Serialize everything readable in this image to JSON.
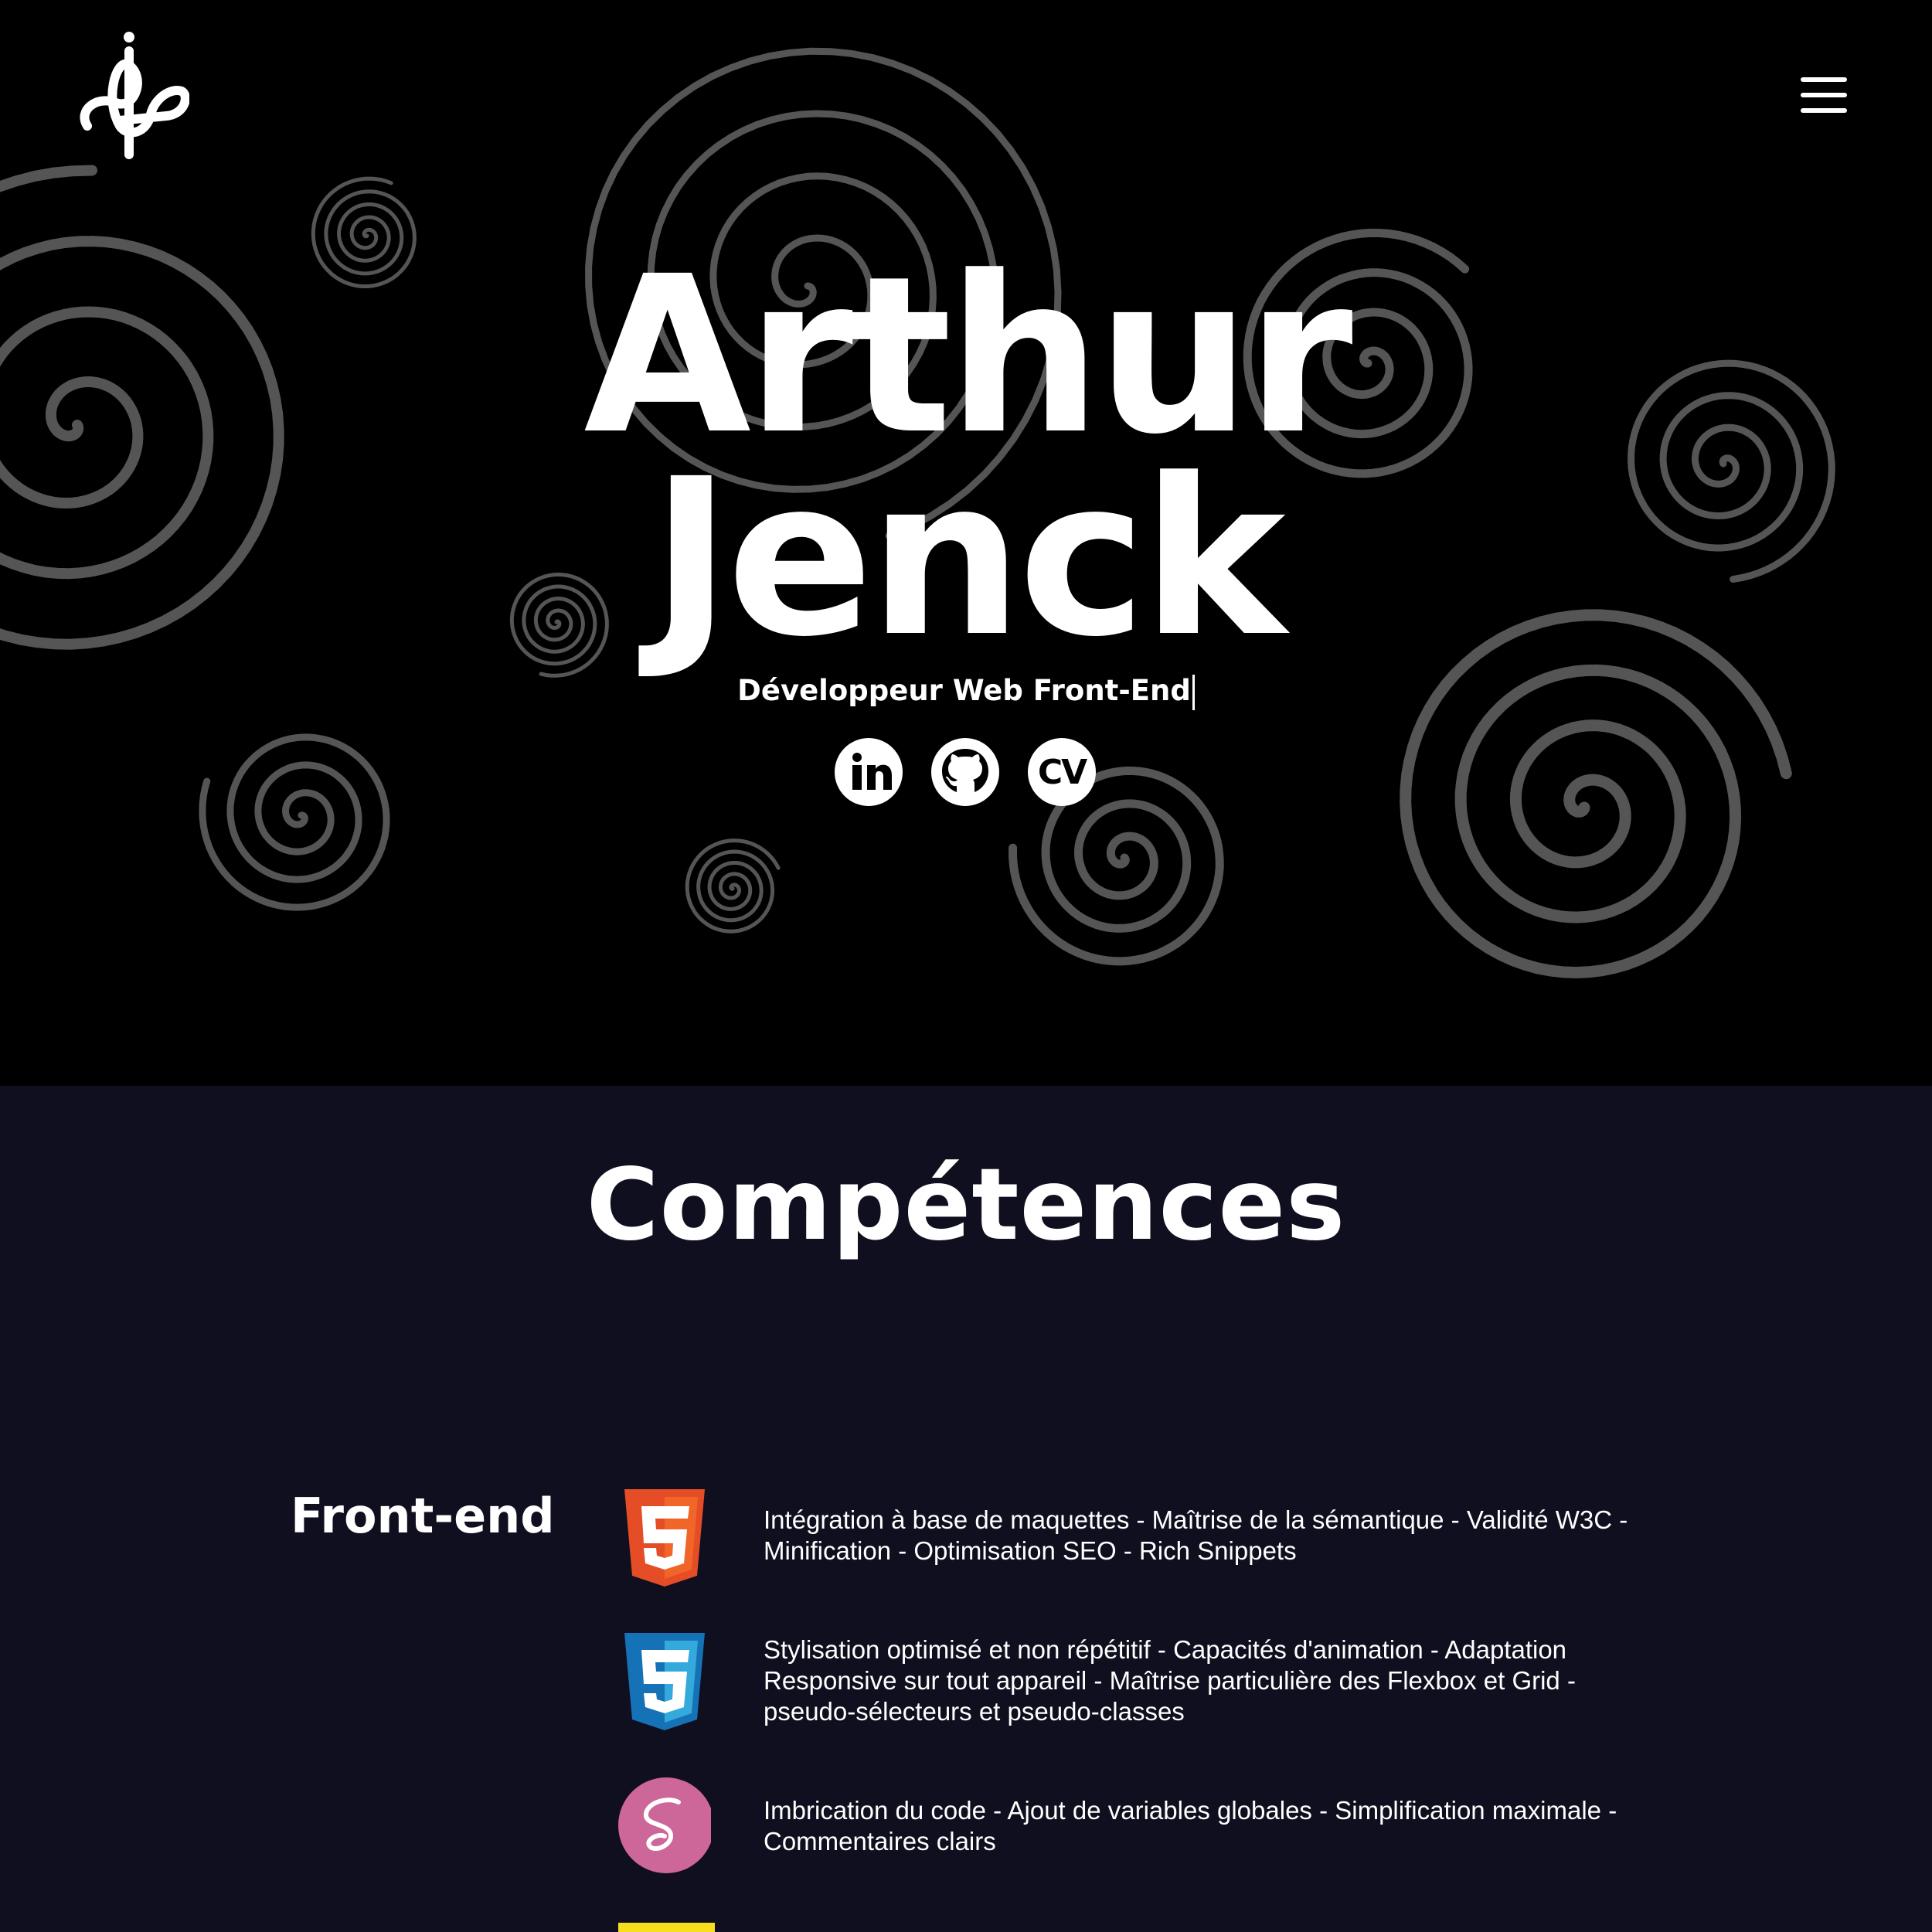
{
  "hero": {
    "first_name": "Arthur",
    "last_name": "Jenck",
    "subtitle": "Développeur Web Front-End",
    "socials": [
      {
        "name": "LinkedIn",
        "icon": "linkedin-icon"
      },
      {
        "name": "GitHub",
        "icon": "github-icon"
      },
      {
        "name": "CV",
        "icon": "cv-icon",
        "text": "CV"
      }
    ]
  },
  "header": {
    "logo": "AJ-monogram-logo",
    "menu_icon": "hamburger-menu-icon"
  },
  "skills": {
    "title": "Compétences",
    "category": "Front-end",
    "items": [
      {
        "icon": "html5-icon",
        "color": "#e44d26",
        "description": "Intégration à base de maquettes - Maîtrise de la sémantique - Validité W3C - Minification - Optimisation SEO - Rich Snippets"
      },
      {
        "icon": "css3-icon",
        "color": "#1572b6",
        "description": "Stylisation optimisé et non répétitif - Capacités d'animation - Adaptation Responsive sur tout appareil - Maîtrise particulière des Flexbox et Grid - pseudo-sélecteurs et pseudo-classes"
      },
      {
        "icon": "sass-icon",
        "color": "#cd6799",
        "description": "Imbrication du code - Ajout de variables globales - Simplification maximale - Commentaires clairs"
      },
      {
        "icon": "javascript-icon",
        "color": "#f7df1e",
        "description": ""
      }
    ]
  },
  "colors": {
    "hero_bg": "#000000",
    "skills_bg": "#100f1f",
    "spiral": "#555555",
    "text": "#ffffff"
  }
}
